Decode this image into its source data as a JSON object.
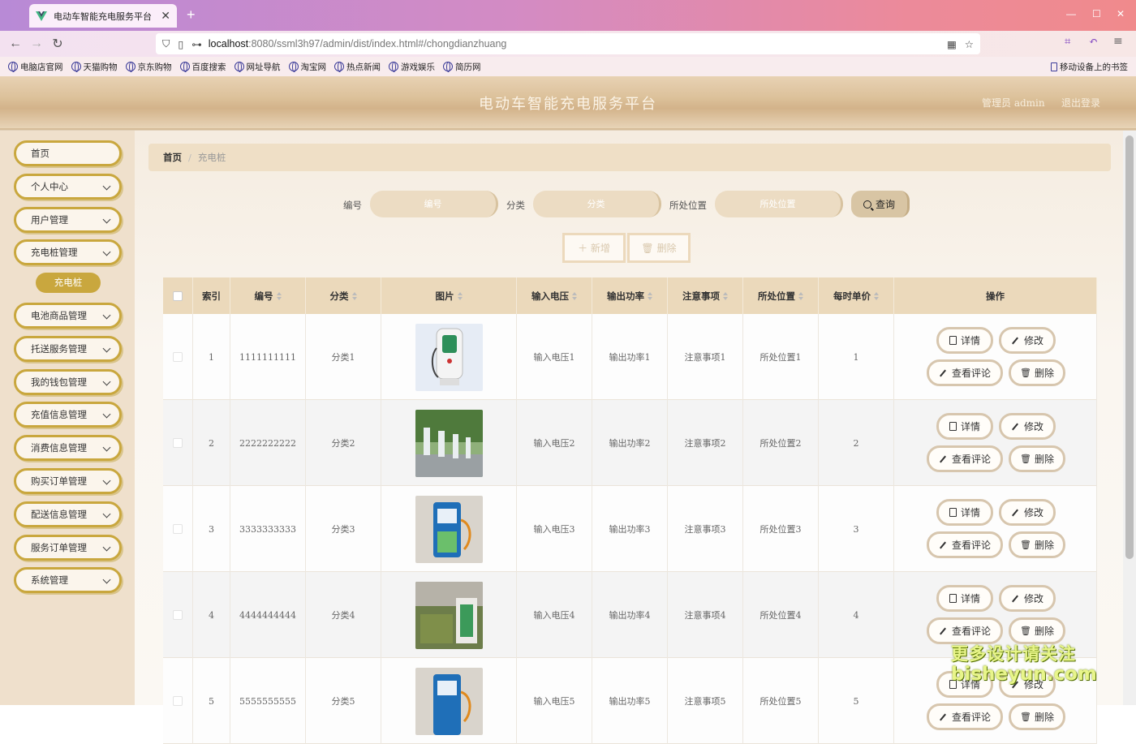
{
  "browser": {
    "tab_title": "电动车智能充电服务平台",
    "url_host": "localhost",
    "url_path": ":8080/ssml3h97/admin/dist/index.html#/chongdianzhuang",
    "bookmarks": [
      "电脑店官网",
      "天猫购物",
      "京东购物",
      "百度搜索",
      "网址导航",
      "淘宝网",
      "热点新闻",
      "游戏娱乐",
      "简历网"
    ],
    "mobile_bookmarks": "移动设备上的书签"
  },
  "header": {
    "title": "电动车智能充电服务平台",
    "user": "管理员 admin",
    "logout": "退出登录"
  },
  "sidebar": {
    "items": [
      {
        "label": "首页",
        "has_chevron": false
      },
      {
        "label": "个人中心",
        "has_chevron": true
      },
      {
        "label": "用户管理",
        "has_chevron": true
      },
      {
        "label": "充电桩管理",
        "has_chevron": true
      },
      {
        "label": "电池商品管理",
        "has_chevron": true
      },
      {
        "label": "托送服务管理",
        "has_chevron": true
      },
      {
        "label": "我的钱包管理",
        "has_chevron": true
      },
      {
        "label": "充值信息管理",
        "has_chevron": true
      },
      {
        "label": "消费信息管理",
        "has_chevron": true
      },
      {
        "label": "购买订单管理",
        "has_chevron": true
      },
      {
        "label": "配送信息管理",
        "has_chevron": true
      },
      {
        "label": "服务订单管理",
        "has_chevron": true
      },
      {
        "label": "系统管理",
        "has_chevron": true
      }
    ],
    "active_sub": "充电桩"
  },
  "breadcrumb": {
    "home": "首页",
    "current": "充电桩"
  },
  "search": {
    "fields": [
      {
        "label": "编号",
        "placeholder": "编号"
      },
      {
        "label": "分类",
        "placeholder": "分类"
      },
      {
        "label": "所处位置",
        "placeholder": "所处位置"
      }
    ],
    "query_button": "查询"
  },
  "actions": {
    "add": "＋ 新增",
    "delete": "删除"
  },
  "table": {
    "headers": [
      "索引",
      "编号",
      "分类",
      "图片",
      "输入电压",
      "输出功率",
      "注意事项",
      "所处位置",
      "每时单价",
      "操作"
    ],
    "rows": [
      {
        "index": "1",
        "code": "1111111111",
        "category": "分类1",
        "voltage": "输入电压1",
        "power": "输出功率1",
        "note": "注意事项1",
        "location": "所处位置1",
        "price": "1"
      },
      {
        "index": "2",
        "code": "2222222222",
        "category": "分类2",
        "voltage": "输入电压2",
        "power": "输出功率2",
        "note": "注意事项2",
        "location": "所处位置2",
        "price": "2"
      },
      {
        "index": "3",
        "code": "3333333333",
        "category": "分类3",
        "voltage": "输入电压3",
        "power": "输出功率3",
        "note": "注意事项3",
        "location": "所处位置3",
        "price": "3"
      },
      {
        "index": "4",
        "code": "4444444444",
        "category": "分类4",
        "voltage": "输入电压4",
        "power": "输出功率4",
        "note": "注意事项4",
        "location": "所处位置4",
        "price": "4"
      },
      {
        "index": "5",
        "code": "5555555555",
        "category": "分类5",
        "voltage": "输入电压5",
        "power": "输出功率5",
        "note": "注意事项5",
        "location": "所处位置5",
        "price": "5"
      }
    ],
    "row_buttons": {
      "detail": "详情",
      "edit": "修改",
      "comments": "查看评论",
      "delete": "删除"
    }
  },
  "watermark": {
    "line1": "更多设计请关注",
    "line2": "bisheyun.com"
  },
  "colors": {
    "accent": "#c9a73e",
    "header_bg": "#dcc19a",
    "table_head": "#ebd9bb"
  }
}
